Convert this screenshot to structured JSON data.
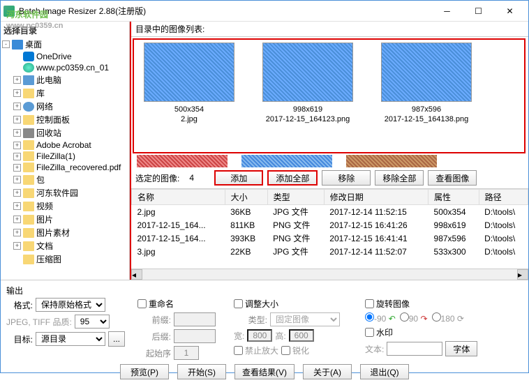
{
  "window": {
    "title": "Batch Image Resizer 2.88(注册版)"
  },
  "watermark": {
    "text": "河东软件园",
    "url": "www.pc0359.cn"
  },
  "sidebar": {
    "header": "选择目录",
    "items": [
      {
        "label": "桌面",
        "icon": "desktop",
        "level": 0,
        "exp": "-"
      },
      {
        "label": "OneDrive",
        "icon": "cloud",
        "level": 1,
        "exp": ""
      },
      {
        "label": "www.pc0359.cn_01",
        "icon": "globe",
        "level": 1,
        "exp": ""
      },
      {
        "label": "此电脑",
        "icon": "pc",
        "level": 1,
        "exp": "+"
      },
      {
        "label": "库",
        "icon": "folder",
        "level": 1,
        "exp": "+"
      },
      {
        "label": "网络",
        "icon": "net",
        "level": 1,
        "exp": "+"
      },
      {
        "label": "控制面板",
        "icon": "folder",
        "level": 1,
        "exp": "+"
      },
      {
        "label": "回收站",
        "icon": "recycle",
        "level": 1,
        "exp": "+"
      },
      {
        "label": "Adobe Acrobat",
        "icon": "folder",
        "level": 1,
        "exp": "+"
      },
      {
        "label": "FileZilla(1)",
        "icon": "folder",
        "level": 1,
        "exp": "+"
      },
      {
        "label": "FileZilla_recovered.pdf",
        "icon": "folder",
        "level": 1,
        "exp": "+"
      },
      {
        "label": "包",
        "icon": "folder",
        "level": 1,
        "exp": "+"
      },
      {
        "label": "河东软件园",
        "icon": "folder",
        "level": 1,
        "exp": "+"
      },
      {
        "label": "视频",
        "icon": "folder",
        "level": 1,
        "exp": "+"
      },
      {
        "label": "图片",
        "icon": "folder",
        "level": 1,
        "exp": "+"
      },
      {
        "label": "图片素材",
        "icon": "folder",
        "level": 1,
        "exp": "+"
      },
      {
        "label": "文档",
        "icon": "folder",
        "level": 1,
        "exp": "+"
      },
      {
        "label": "压缩图",
        "icon": "folder",
        "level": 1,
        "exp": ""
      }
    ]
  },
  "content": {
    "header": "目录中的图像列表:",
    "thumbs": [
      {
        "dim": "500x354",
        "name": "2.jpg"
      },
      {
        "dim": "998x619",
        "name": "2017-12-15_164123.png"
      },
      {
        "dim": "987x596",
        "name": "2017-12-15_164138.png"
      }
    ],
    "selected_label": "选定的图像:",
    "selected_count": "4",
    "buttons": {
      "add": "添加",
      "addall": "添加全部",
      "remove": "移除",
      "removeall": "移除全部",
      "view": "查看图像"
    }
  },
  "table": {
    "cols": [
      "名称",
      "大小",
      "类型",
      "修改日期",
      "属性",
      "路径"
    ],
    "rows": [
      [
        "2.jpg",
        "36KB",
        "JPG 文件",
        "2017-12-14 11:52:15",
        "500x354",
        "D:\\tools\\"
      ],
      [
        "2017-12-15_164...",
        "811KB",
        "PNG 文件",
        "2017-12-15 16:41:26",
        "998x619",
        "D:\\tools\\"
      ],
      [
        "2017-12-15_164...",
        "393KB",
        "PNG 文件",
        "2017-12-15 16:41:41",
        "987x596",
        "D:\\tools\\"
      ],
      [
        "3.jpg",
        "22KB",
        "JPG 文件",
        "2017-12-14 11:52:07",
        "533x300",
        "D:\\tools\\"
      ]
    ]
  },
  "output": {
    "section": "输出",
    "format_label": "格式:",
    "format_value": "保持原始格式",
    "quality_label": "JPEG, TIFF 品质:",
    "quality_value": "95",
    "target_label": "目标:",
    "target_value": "源目录",
    "rename": {
      "chk": "重命名",
      "prefix": "前缀:",
      "suffix": "后缀:",
      "start": "起始序",
      "start_val": "1"
    },
    "resize": {
      "chk": "调整大小",
      "type": "类型:",
      "type_val": "固定图像",
      "w": "宽:",
      "w_val": "800",
      "h": "高:",
      "h_val": "600",
      "noenlarge": "禁止放大",
      "sharpen": "锐化"
    },
    "rotate": {
      "chk": "旋转图像",
      "m90": "-90",
      "p90": "90",
      "p180": "180"
    },
    "watermark": {
      "chk": "水印",
      "text": "文本:",
      "font_btn": "字体"
    },
    "actions": {
      "preview": "预览(P)",
      "start": "开始(S)",
      "result": "查看结果(V)",
      "about": "关于(A)",
      "exit": "退出(Q)"
    }
  }
}
